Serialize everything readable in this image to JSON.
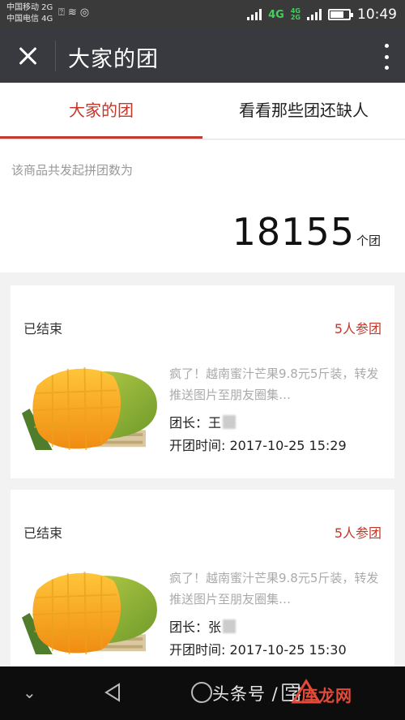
{
  "status_bar": {
    "carrier_1": "中国移动 2G",
    "carrier_2": "中国电信 4G",
    "network_label": "4G",
    "network_label_small_1": "4G",
    "network_label_small_2": "2G",
    "time": "10:49",
    "battery_level": 0.68
  },
  "app_bar": {
    "title": "大家的团",
    "close_icon": "close-icon",
    "more_icon": "more-vertical-icon"
  },
  "tabs": [
    {
      "label": "大家的团",
      "active": true
    },
    {
      "label": "看看那些团还缺人",
      "active": false
    }
  ],
  "summary": {
    "label": "该商品共发起拼团数为",
    "count": "18155",
    "unit": "个团"
  },
  "groups": [
    {
      "status": "已结束",
      "participants": "5人参团",
      "description": "疯了！越南蜜汁芒果9.8元5斤装，转发推送图片至朋友圈集…",
      "leader": "团长：王",
      "open_time": "开团时间: 2017-10-25 15:29"
    },
    {
      "status": "已结束",
      "participants": "5人参团",
      "description": "疯了！越南蜜汁芒果9.8元5斤装，转发推送图片至朋友圈集…",
      "leader": "团长：张",
      "open_time": "开团时间: 2017-10-25 15:30"
    }
  ],
  "nav_bar": {
    "watermark": "头条号 / 字",
    "watermark_logo": "库龙网"
  },
  "colors": {
    "accent_red": "#c43a2f",
    "app_bar": "#393a3f",
    "mango": "#f2a51a"
  }
}
